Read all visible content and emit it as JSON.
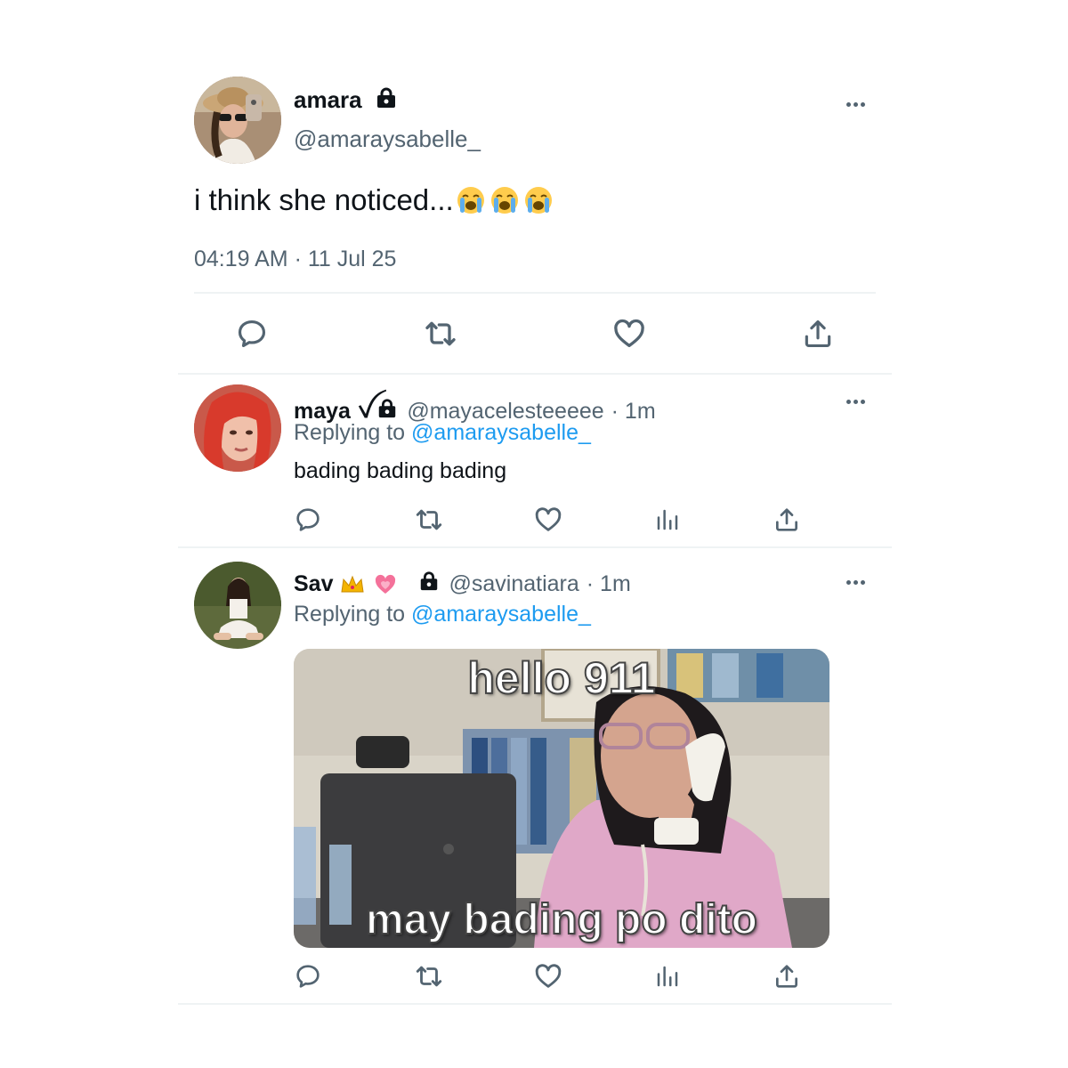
{
  "main_tweet": {
    "display_name": "amara",
    "handle": "@amaraysabelle_",
    "text": "i think she noticed...",
    "emojis": [
      "loudly-crying-face",
      "loudly-crying-face",
      "loudly-crying-face"
    ],
    "timestamp": "04:19 AM · 11 Jul 25",
    "avatar": "amara-avatar"
  },
  "replies": [
    {
      "display_name": "maya",
      "name_symbol": "ꪜ",
      "handle": "@mayacelesteeeee",
      "time": "· 1m",
      "replying_prefix": "Replying to",
      "replying_handle": "@amaraysabelle_",
      "text": "bading bading bading"
    },
    {
      "display_name": "Sav",
      "name_emojis": [
        "crown-icon",
        "growing-heart-icon"
      ],
      "handle": "@savinatiara",
      "time": "· 1m",
      "replying_prefix": "Replying to",
      "replying_handle": "@amaraysabelle_",
      "media": {
        "top_caption": "hello 911",
        "bottom_caption": "may bading po dito"
      }
    }
  ],
  "colors": {
    "link": "#1d9bf0",
    "secondary_text": "#536471",
    "divider": "#eff3f4"
  },
  "icons": {
    "actions_main": [
      "reply-icon",
      "retweet-icon",
      "like-icon",
      "share-icon"
    ],
    "actions_reply": [
      "reply-icon",
      "retweet-icon",
      "like-icon",
      "views-icon",
      "share-icon"
    ],
    "protected": "lock-icon",
    "more": "more-icon"
  }
}
